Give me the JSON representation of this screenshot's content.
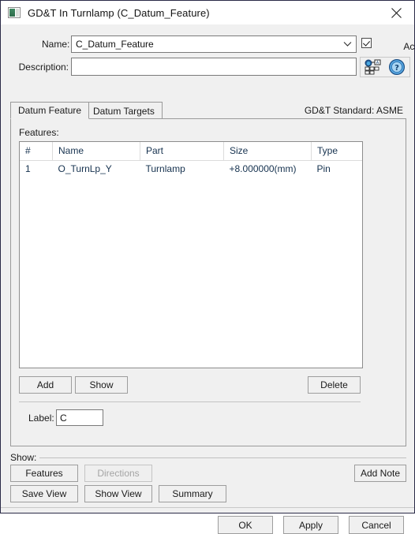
{
  "window": {
    "title": "GD&T In Turnlamp (C_Datum_Feature)",
    "icon": "window-gradient-icon",
    "close_icon": "close-icon"
  },
  "form": {
    "name_label": "Name:",
    "name_value": "C_Datum_Feature",
    "name_dropdown_icon": "chevron-down-icon",
    "active_label": "Active",
    "active_checked": true,
    "description_label": "Description:",
    "description_value": "",
    "description_placeholder": "",
    "annotation_icon": "gdt-annotation-icon",
    "help_icon": "help-question-icon"
  },
  "tabs": [
    {
      "label": "Datum Feature",
      "active": true
    },
    {
      "label": "Datum Targets",
      "active": false
    }
  ],
  "standard_text": "GD&T Standard: ASME",
  "features": {
    "section_label": "Features:",
    "columns": [
      "#",
      "Name",
      "Part",
      "Size",
      "Type"
    ],
    "rows": [
      {
        "num": "1",
        "name": "O_TurnLp_Y",
        "part": "Turnlamp",
        "size": "+8.000000(mm)",
        "type": "Pin"
      }
    ],
    "add_label": "Add",
    "show_label": "Show",
    "delete_label": "Delete"
  },
  "label_field": {
    "label": "Label:",
    "value": "C"
  },
  "show_group": {
    "group_label": "Show:",
    "features_label": "Features",
    "directions_label": "Directions",
    "directions_disabled": true,
    "add_note_label": "Add Note",
    "save_view_label": "Save View",
    "show_view_label": "Show View",
    "summary_label": "Summary"
  },
  "footer": {
    "ok_label": "OK",
    "apply_label": "Apply",
    "cancel_label": "Cancel"
  },
  "colors": {
    "dialog_bg": "#f0f0f0",
    "border": "#2a2a47",
    "text": "#1a1a1a",
    "table_text": "#16324f",
    "disabled_text": "#a4a4a4"
  }
}
